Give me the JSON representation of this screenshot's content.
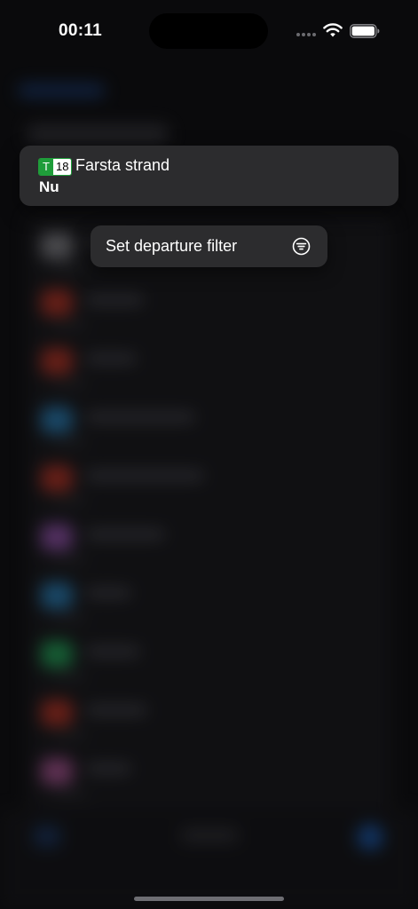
{
  "status_bar": {
    "time": "00:11"
  },
  "preview": {
    "line_mode": "T",
    "line_number": "18",
    "destination": "Farsta strand",
    "departure": "Nu",
    "line_color": "#1f9d3a"
  },
  "context_menu": {
    "items": [
      {
        "label": "Set departure filter",
        "icon": "filter-icon"
      }
    ]
  },
  "background_rows_colors": [
    "#8a8a90",
    "#c0392b",
    "#c0392b",
    "#2e86c1",
    "#c0392b",
    "#9b59b6",
    "#2e86c1",
    "#27ae60",
    "#c0392b",
    "#b05a9a"
  ]
}
